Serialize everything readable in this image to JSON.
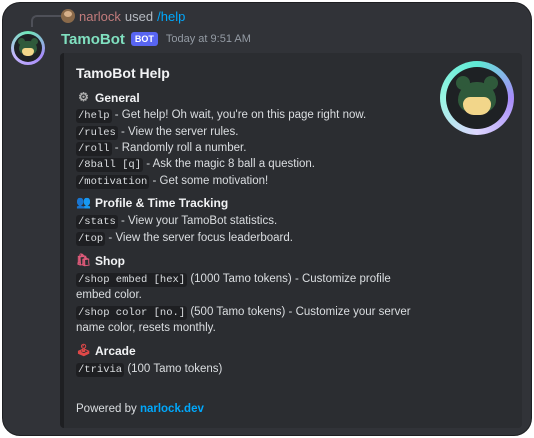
{
  "reply": {
    "user": "narlock",
    "used_text": "used",
    "command": "/help"
  },
  "message": {
    "bot_name": "TamoBot",
    "badge": "BOT",
    "timestamp": "Today at 9:51 AM"
  },
  "embed": {
    "title": "TamoBot Help",
    "sections": {
      "general": {
        "icon": "gear-icon",
        "title": "General",
        "items": [
          {
            "cmd": "/help",
            "desc": "- Get help! Oh wait, you're on this page right now."
          },
          {
            "cmd": "/rules",
            "desc": "- View the server rules."
          },
          {
            "cmd": "/roll",
            "desc": "- Randomly roll a number."
          },
          {
            "cmd": "/8ball [q]",
            "desc": "- Ask the magic 8 ball a question."
          },
          {
            "cmd": "/motivation",
            "desc": "- Get some motivation!"
          }
        ]
      },
      "profile": {
        "icon": "people-icon",
        "title": "Profile & Time Tracking",
        "items": [
          {
            "cmd": "/stats",
            "desc": "- View your TamoBot statistics."
          },
          {
            "cmd": "/top",
            "desc": "- View the server focus leaderboard."
          }
        ]
      },
      "shop": {
        "icon": "shopping-bag-icon",
        "title": "Shop",
        "items": [
          {
            "cmd": "/shop embed [hex]",
            "desc": "(1000 Tamo tokens) - Customize profile",
            "desc2": "embed color."
          },
          {
            "cmd": "/shop color [no.]",
            "desc": "(500 Tamo tokens) - Customize your server",
            "desc2": "name color, resets monthly."
          }
        ]
      },
      "arcade": {
        "icon": "joystick-icon",
        "title": "Arcade",
        "items": [
          {
            "cmd": "/trivia",
            "desc": "(100 Tamo tokens)"
          }
        ]
      }
    },
    "footer": {
      "prefix": "Powered by",
      "link": "narlock.dev"
    }
  },
  "colors": {
    "background": "#313338",
    "embed_bg": "#2b2d31",
    "bot_name": "#80e0c0",
    "link": "#00a8fc",
    "badge": "#5865f2"
  }
}
